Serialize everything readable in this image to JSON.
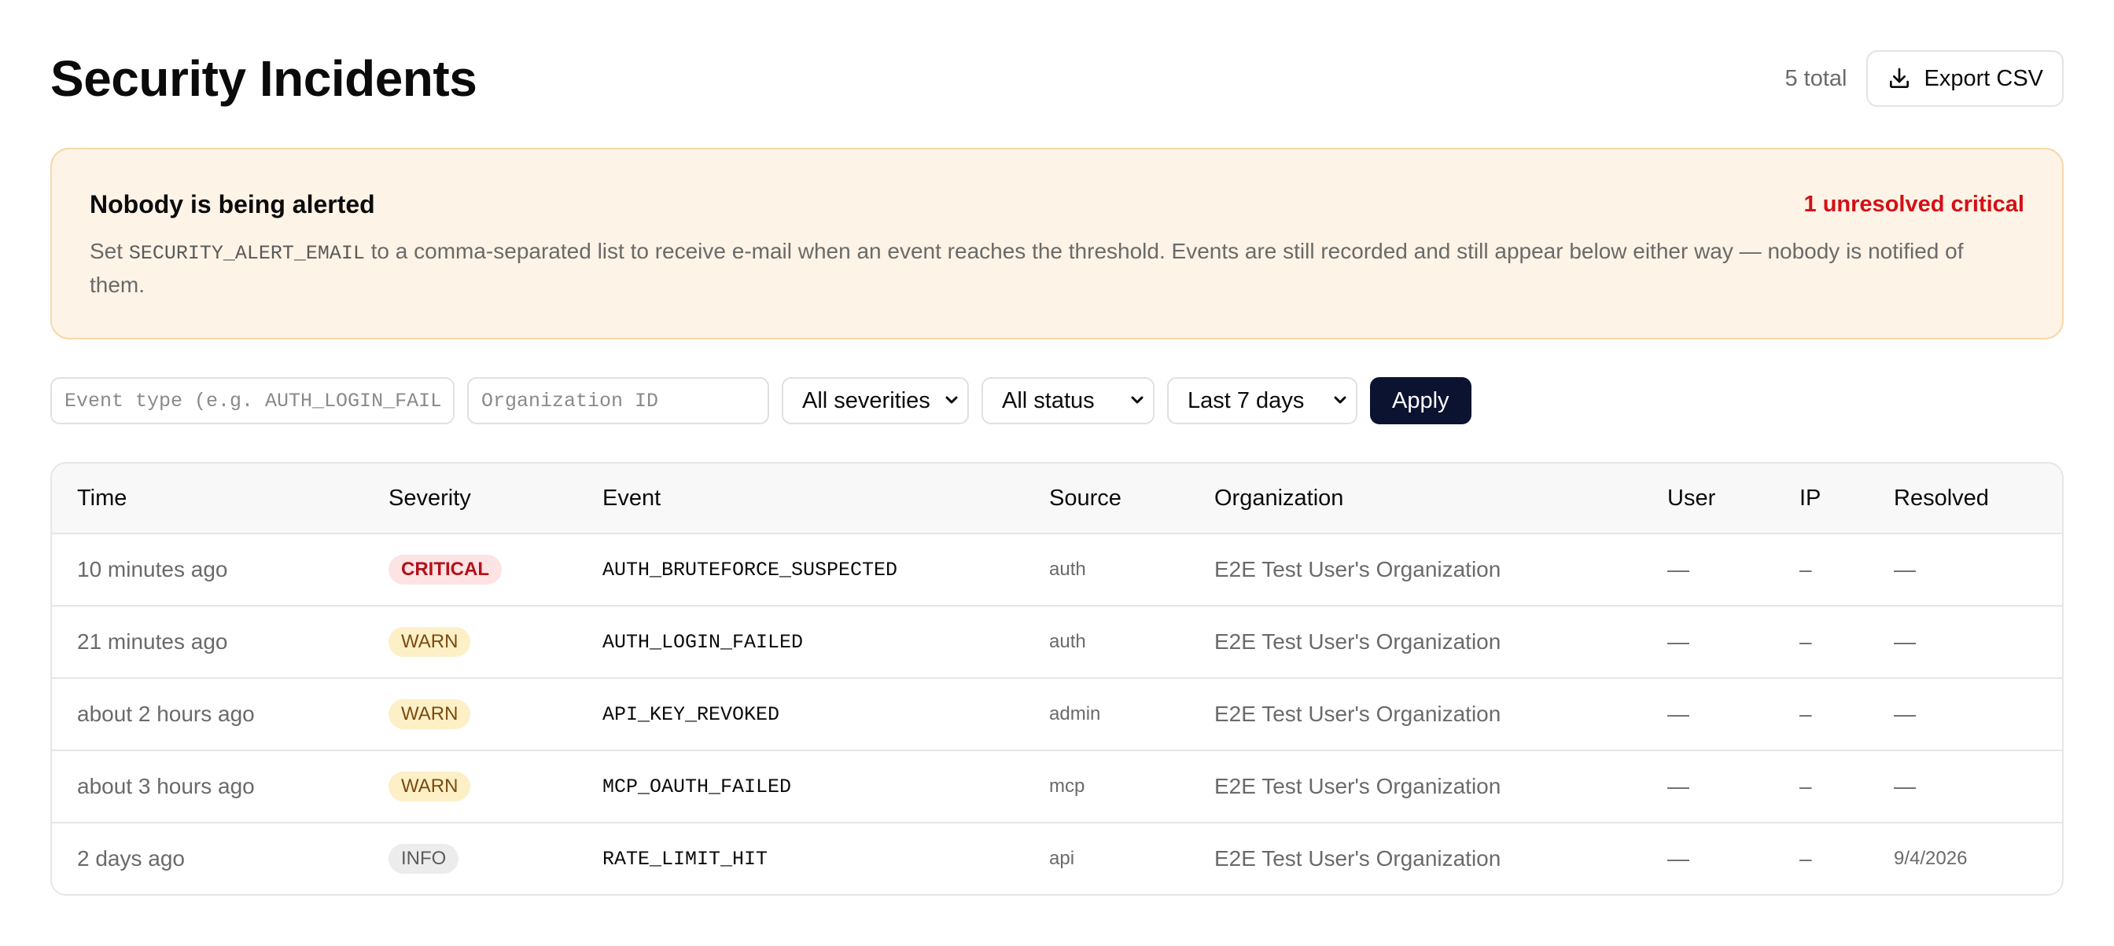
{
  "header": {
    "title": "Security Incidents",
    "total": "5 total",
    "export_label": "Export CSV"
  },
  "alert": {
    "title": "Nobody is being alerted",
    "critical": "1 unresolved critical",
    "body_prefix": "Set ",
    "body_code": "SECURITY_ALERT_EMAIL",
    "body_suffix": " to a comma-separated list to receive e-mail when an event reaches the threshold. Events are still recorded and still appear below either way — nobody is notified of them."
  },
  "filters": {
    "event_type_placeholder": "Event type (e.g. AUTH_LOGIN_FAILED)",
    "event_type_value": "",
    "organization_placeholder": "Organization ID",
    "organization_value": "",
    "severity_selected": "All severities",
    "status_selected": "All status",
    "range_selected": "Last 7 days",
    "apply_label": "Apply"
  },
  "table": {
    "columns": {
      "time": "Time",
      "severity": "Severity",
      "event": "Event",
      "source": "Source",
      "organization": "Organization",
      "user": "User",
      "ip": "IP",
      "resolved": "Resolved"
    },
    "rows": [
      {
        "time": "10 minutes ago",
        "severity": "CRITICAL",
        "level": "critical",
        "event": "AUTH_BRUTEFORCE_SUSPECTED",
        "source": "auth",
        "organization": "E2E Test User's Organization",
        "user": "—",
        "ip": "–",
        "resolved": "—"
      },
      {
        "time": "21 minutes ago",
        "severity": "WARN",
        "level": "warn",
        "event": "AUTH_LOGIN_FAILED",
        "source": "auth",
        "organization": "E2E Test User's Organization",
        "user": "—",
        "ip": "–",
        "resolved": "—"
      },
      {
        "time": "about 2 hours ago",
        "severity": "WARN",
        "level": "warn",
        "event": "API_KEY_REVOKED",
        "source": "admin",
        "organization": "E2E Test User's Organization",
        "user": "—",
        "ip": "–",
        "resolved": "—"
      },
      {
        "time": "about 3 hours ago",
        "severity": "WARN",
        "level": "warn",
        "event": "MCP_OAUTH_FAILED",
        "source": "mcp",
        "organization": "E2E Test User's Organization",
        "user": "—",
        "ip": "–",
        "resolved": "—"
      },
      {
        "time": "2 days ago",
        "severity": "INFO",
        "level": "info",
        "event": "RATE_LIMIT_HIT",
        "source": "api",
        "organization": "E2E Test User's Organization",
        "user": "—",
        "ip": "–",
        "resolved": "9/4/2026"
      }
    ]
  },
  "icons": {
    "export": "download-icon",
    "dropdown": "chevron-down-icon"
  },
  "colors": {
    "alert_background": "#fdf3e6",
    "alert_border": "#f6d9a9",
    "critical_text": "#d40f16",
    "apply_button": "#0c1331",
    "badge_critical_bg": "#fde3e3",
    "badge_warn_bg": "#fdf0c6",
    "badge_info_bg": "#ececec"
  }
}
